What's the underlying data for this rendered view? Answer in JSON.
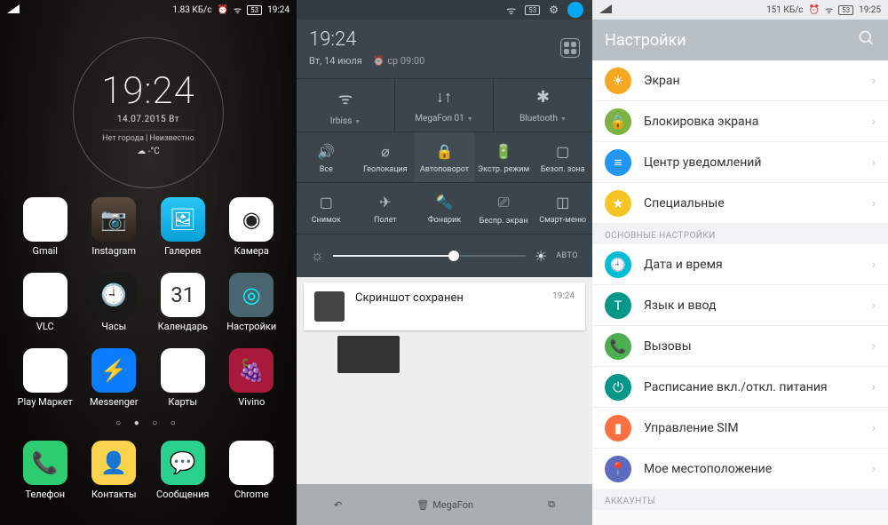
{
  "panel1": {
    "status": {
      "speed": "1.83 КБ/с",
      "battery": "53",
      "time": "19:24"
    },
    "clock": {
      "time": "19:24",
      "date": "14.07.2015 Вт",
      "location": "Нет города | Неизвестно",
      "weather": "☁  -°C"
    },
    "apps_row1": [
      {
        "label": "Gmail",
        "cls": "gmail",
        "glyph": "M"
      },
      {
        "label": "Instagram",
        "cls": "instagram",
        "glyph": "📷"
      },
      {
        "label": "Галерея",
        "cls": "gallery",
        "glyph": "🖼"
      },
      {
        "label": "Камера",
        "cls": "camera",
        "glyph": "◉"
      }
    ],
    "apps_row2": [
      {
        "label": "VLC",
        "cls": "vlc",
        "glyph": "△"
      },
      {
        "label": "Часы",
        "cls": "clock",
        "glyph": "🕘"
      },
      {
        "label": "Календарь",
        "cls": "calendar",
        "glyph": "31"
      },
      {
        "label": "Настройки",
        "cls": "settings",
        "glyph": "◎"
      }
    ],
    "apps_row3": [
      {
        "label": "Play Маркет",
        "cls": "play",
        "glyph": "▶"
      },
      {
        "label": "Messenger",
        "cls": "messenger",
        "glyph": "⚡"
      },
      {
        "label": "Карты",
        "cls": "maps",
        "glyph": "9"
      },
      {
        "label": "Vivino",
        "cls": "vivino",
        "glyph": "🍇"
      }
    ],
    "dock": [
      {
        "label": "Телефон",
        "cls": "phone",
        "glyph": "📞"
      },
      {
        "label": "Контакты",
        "cls": "contacts",
        "glyph": "👤"
      },
      {
        "label": "Сообщения",
        "cls": "sms",
        "glyph": "💬"
      },
      {
        "label": "Chrome",
        "cls": "chrome",
        "glyph": "◯"
      }
    ]
  },
  "panel2": {
    "status_battery": "53",
    "shade": {
      "time": "19:24",
      "date": "Вт, 14 июля",
      "alarm": "⏰ ср 09:00"
    },
    "conns": [
      {
        "icon": "wifi",
        "glyph": "ᯤ",
        "label": "Irbiss"
      },
      {
        "icon": "data",
        "glyph": "↓↑",
        "label": "MegaFon 01"
      },
      {
        "icon": "bluetooth",
        "glyph": "✱",
        "label": "Bluetooth"
      }
    ],
    "toggles1": [
      {
        "label": "Все",
        "glyph": "🔊",
        "name": "sound"
      },
      {
        "label": "Геолокация",
        "glyph": "⌀",
        "name": "location"
      },
      {
        "label": "Автоповорот",
        "glyph": "🔒",
        "name": "rotate",
        "active": true
      },
      {
        "label": "Экстр. режим",
        "glyph": "🔋",
        "name": "battery"
      },
      {
        "label": "Безоп. зона",
        "glyph": "▢",
        "name": "secure"
      }
    ],
    "toggles2": [
      {
        "label": "Снимок",
        "glyph": "▢",
        "name": "screenshot"
      },
      {
        "label": "Полет",
        "glyph": "✈",
        "name": "airplane"
      },
      {
        "label": "Фонарик",
        "glyph": "🔦",
        "name": "torch"
      },
      {
        "label": "Беспр. экран",
        "glyph": "⎚",
        "name": "cast"
      },
      {
        "label": "Смарт-меню",
        "glyph": "◫",
        "name": "smart"
      }
    ],
    "brightness": {
      "auto_label": "АВТО",
      "value": 63
    },
    "notification": {
      "title": "Скриншот сохранен",
      "time": "19:24"
    },
    "navbar_label": "MegaFon"
  },
  "panel3": {
    "status": {
      "speed": "151 КБ/с",
      "battery": "53",
      "time": "19:25"
    },
    "title": "Настройки",
    "section_label": "ОСНОВНЫЕ НАСТРОЙКИ",
    "accounts_label": "АККАУНТЫ",
    "group1": [
      {
        "label": "Экран",
        "cls": "ic-orange",
        "glyph": "☀"
      },
      {
        "label": "Блокировка экрана",
        "cls": "ic-green",
        "glyph": "🔒"
      },
      {
        "label": "Центр уведомлений",
        "cls": "ic-blue",
        "glyph": "≡"
      },
      {
        "label": "Специальные",
        "cls": "ic-yellow",
        "glyph": "★"
      }
    ],
    "group2": [
      {
        "label": "Дата и время",
        "cls": "ic-cyan",
        "glyph": "🕘"
      },
      {
        "label": "Язык и ввод",
        "cls": "ic-teal",
        "glyph": "T"
      },
      {
        "label": "Вызовы",
        "cls": "ic-call",
        "glyph": "📞"
      },
      {
        "label": "Расписание вкл./откл. питания",
        "cls": "ic-sched",
        "glyph": "⏻"
      },
      {
        "label": "Управление SIM",
        "cls": "ic-sim",
        "glyph": "▮"
      },
      {
        "label": "Мое местоположение",
        "cls": "ic-loc",
        "glyph": "📍"
      }
    ]
  }
}
